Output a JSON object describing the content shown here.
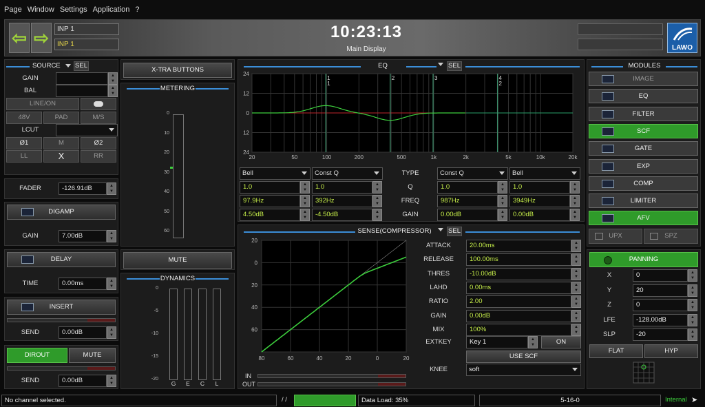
{
  "menu": [
    "Page",
    "Window",
    "Settings",
    "Application",
    "?"
  ],
  "header": {
    "inp1": "INP   1",
    "inp2": "INP   1",
    "clock": "10:23:13",
    "subtitle": "Main Display",
    "logo": "LAWO"
  },
  "source": {
    "title": "SOURCE",
    "sel": "SEL",
    "gain": "GAIN",
    "bal": "BAL",
    "lineon": "LINE/ON",
    "v48": "48V",
    "pad": "PAD",
    "ms": "M/S",
    "lcut": "LCUT",
    "phi1": "Ø1",
    "m": "M",
    "phi2": "Ø2",
    "ll": "LL",
    "x": "X",
    "rr": "RR"
  },
  "fader": {
    "label": "FADER",
    "value": "-126.91dB"
  },
  "digamp": {
    "label": "DIGAMP",
    "gain_label": "GAIN",
    "gain": "7.00dB"
  },
  "delay": {
    "label": "DELAY",
    "time_label": "TIME",
    "time": "0.00ms"
  },
  "insert": {
    "label": "INSERT",
    "send_label": "SEND",
    "send": "0.00dB"
  },
  "dirout": {
    "label": "DIROUT",
    "mute": "MUTE",
    "send_label": "SEND",
    "send": "0.00dB"
  },
  "xtra": "X-TRA BUTTONS",
  "metering": {
    "title": "METERING",
    "scale": [
      "0",
      "10",
      "20",
      "30",
      "40",
      "50",
      "60"
    ]
  },
  "mute": "MUTE",
  "dynamics": {
    "title": "DYNAMICS",
    "scale": [
      "0",
      "-5",
      "-10",
      "-15",
      "-20"
    ],
    "labels": [
      "G",
      "E",
      "C",
      "L"
    ]
  },
  "eq": {
    "title": "EQ",
    "sel": "SEL",
    "yticks": [
      "24",
      "12",
      "0",
      "12",
      "24"
    ],
    "xticks": [
      "20",
      "50",
      "100",
      "200",
      "500",
      "1k",
      "2k",
      "5k",
      "10k",
      "20k"
    ],
    "bands": [
      {
        "n": "1",
        "sub": "1"
      },
      {
        "n": "2",
        "sub": ""
      },
      {
        "n": "3",
        "sub": ""
      },
      {
        "n": "4",
        "sub": "2"
      }
    ],
    "col1": {
      "type": "Bell",
      "q": "1.0",
      "freq": "97.9Hz",
      "gain": "4.50dB"
    },
    "col2": {
      "type": "Const Q",
      "q": "1.0",
      "freq": "392Hz",
      "gain": "-4.50dB"
    },
    "col3": {
      "type": "Const Q",
      "q": "1.0",
      "freq": "987Hz",
      "gain": "0.00dB"
    },
    "col4": {
      "type": "Bell",
      "q": "1.0",
      "freq": "3949Hz",
      "gain": "0.00dB"
    },
    "row_labels": [
      "TYPE",
      "Q",
      "FREQ",
      "GAIN"
    ]
  },
  "comp": {
    "title": "SENSE(COMPRESSOR)",
    "sel": "SEL",
    "yticks": [
      "20",
      "0",
      "20",
      "40",
      "60"
    ],
    "xticks": [
      "80",
      "60",
      "40",
      "20",
      "0",
      "20"
    ],
    "in": "IN",
    "out": "OUT",
    "params": [
      {
        "k": "ATTACK",
        "v": "20.00ms"
      },
      {
        "k": "RELEASE",
        "v": "100.00ms"
      },
      {
        "k": "THRES",
        "v": "-10.00dB"
      },
      {
        "k": "LAHD",
        "v": "0.00ms"
      },
      {
        "k": "RATIO",
        "v": "2.00"
      },
      {
        "k": "GAIN",
        "v": "0.00dB"
      },
      {
        "k": "MIX",
        "v": "100%"
      }
    ],
    "extkey": "EXTKEY",
    "key": "Key  1",
    "on": "ON",
    "usescf": "USE SCF",
    "knee_label": "KNEE",
    "knee": "soft"
  },
  "modules": {
    "title": "MODULES",
    "items": [
      "IMAGE",
      "EQ",
      "FILTER",
      "SCF",
      "GATE",
      "EXP",
      "COMP",
      "LIMITER",
      "AFV"
    ],
    "upx": "UPX",
    "spz": "SPZ"
  },
  "panning": {
    "label": "PANNING",
    "rows": [
      {
        "k": "X",
        "v": "0"
      },
      {
        "k": "Y",
        "v": "20"
      },
      {
        "k": "Z",
        "v": "0"
      },
      {
        "k": "LFE",
        "v": "-128.00dB"
      },
      {
        "k": "SLP",
        "v": "-20"
      }
    ],
    "flat": "FLAT",
    "hyp": "HYP"
  },
  "status": {
    "msg": "No channel selected.",
    "slash": "/  /",
    "load": "Data Load: 35%",
    "code": "5-16-0",
    "internal": "Internal"
  },
  "colors": {
    "accent_green": "#2f9b2a",
    "curve_green": "#3dcf3d",
    "value_green": "#c7ef4a",
    "title_line": "#3b8ed8"
  }
}
